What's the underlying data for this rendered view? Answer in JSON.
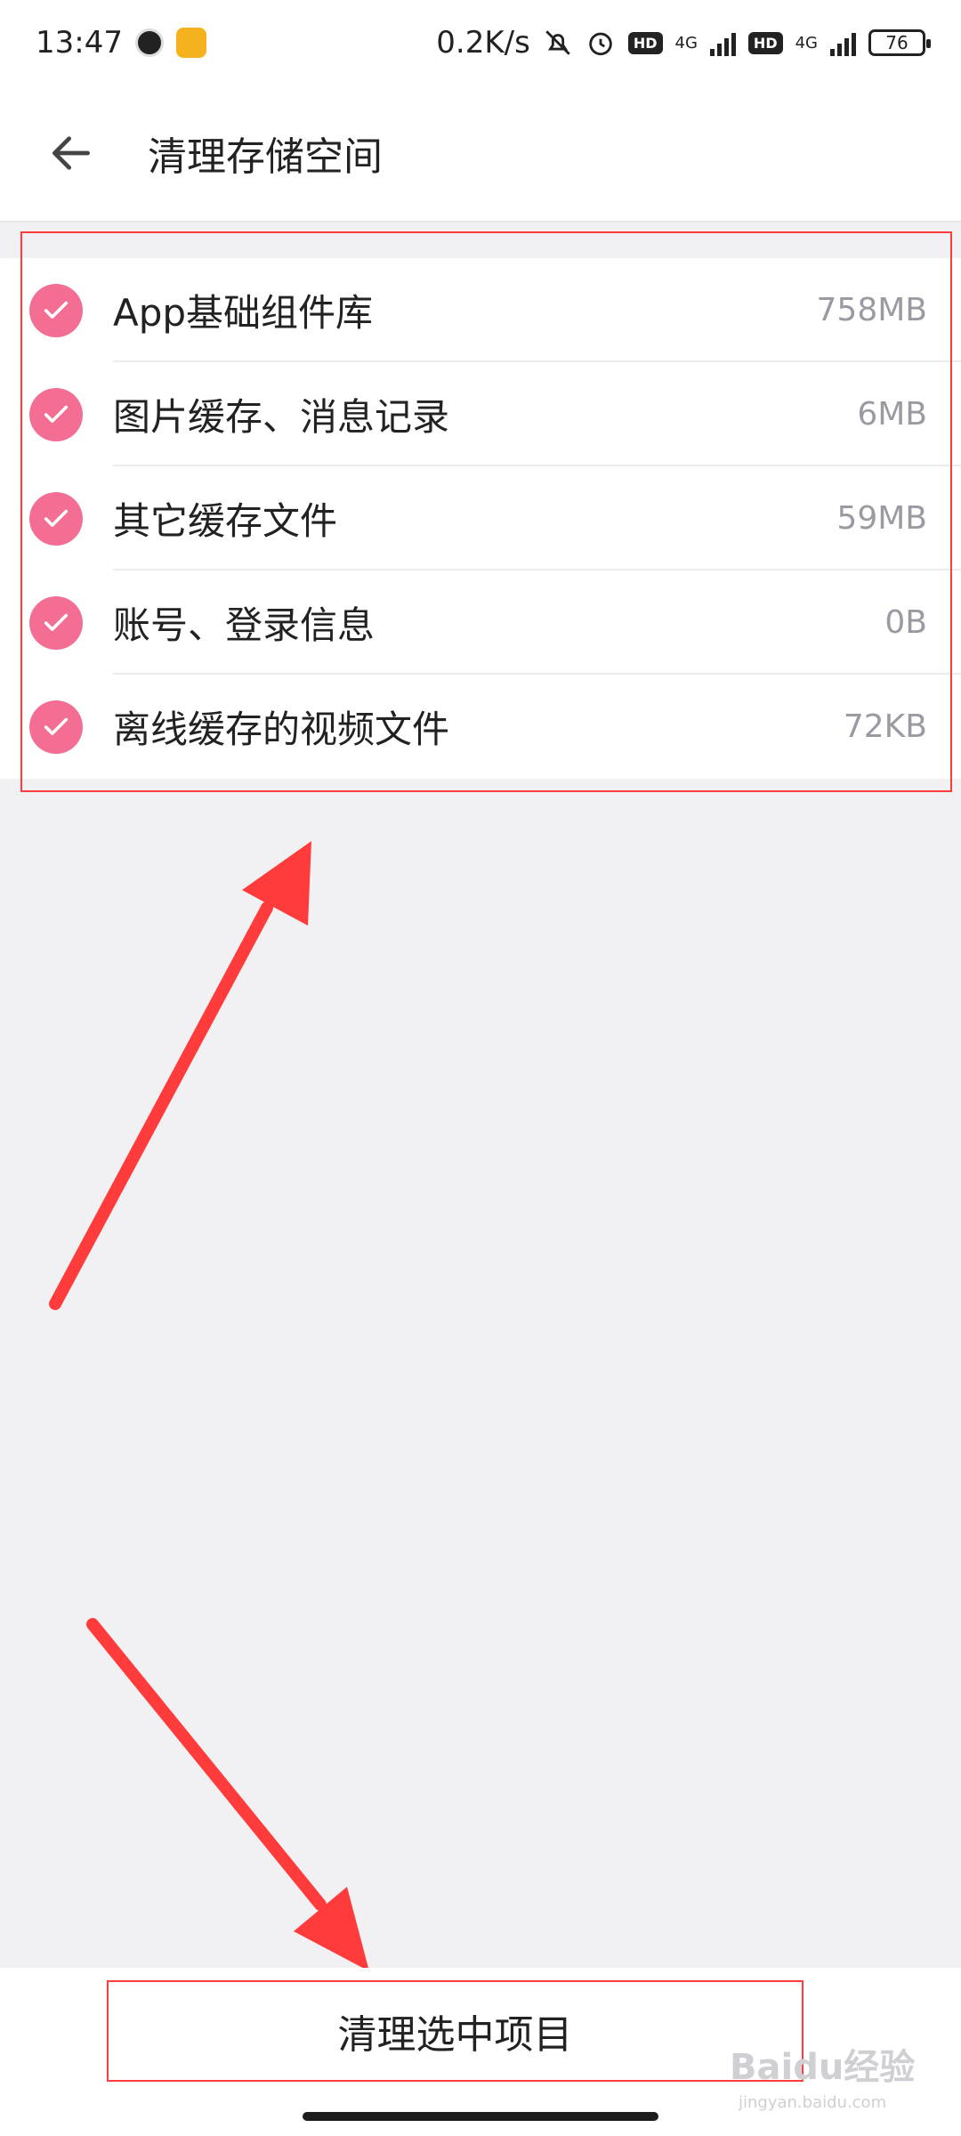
{
  "status_bar": {
    "time": "13:47",
    "net_speed": "0.2K/s",
    "hd_label_1": "HD",
    "network_1": "4G",
    "hd_label_2": "HD",
    "network_2": "4G",
    "battery": "76"
  },
  "header": {
    "title": "清理存储空间",
    "back_icon": "arrow-left-icon"
  },
  "items": [
    {
      "label": "App基础组件库",
      "size": "758MB",
      "checked": true
    },
    {
      "label": "图片缓存、消息记录",
      "size": "6MB",
      "checked": true
    },
    {
      "label": "其它缓存文件",
      "size": "59MB",
      "checked": true
    },
    {
      "label": "账号、登录信息",
      "size": "0B",
      "checked": true
    },
    {
      "label": "离线缓存的视频文件",
      "size": "72KB",
      "checked": true
    }
  ],
  "footer": {
    "clean_button": "清理选中项目"
  },
  "watermark": {
    "brand": "Baidu经验",
    "url": "jingyan.baidu.com"
  },
  "colors": {
    "accent": "#f46e94",
    "annotation": "#ff3b3b"
  }
}
